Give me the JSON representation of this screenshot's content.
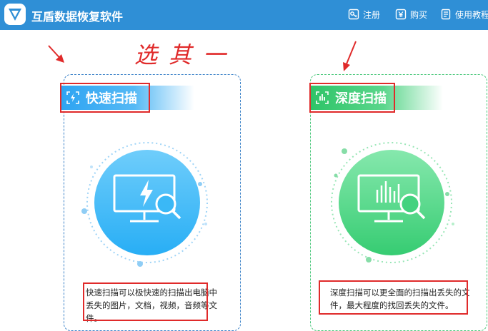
{
  "app": {
    "title": "互盾数据恢复软件"
  },
  "toolbar": {
    "register_label": "注册",
    "buy_label": "购买",
    "tutorial_label": "使用教程"
  },
  "annotation": {
    "handwriting": "选其一"
  },
  "quick_scan": {
    "label": "快速扫描",
    "description": "快速扫描可以极快速的扫描出电脑中丢失的图片，文档，视频，音频等文件。",
    "accent": "#2ea4f2"
  },
  "deep_scan": {
    "label": "深度扫描",
    "description": "深度扫描可以更全面的扫描出丢失的文件，最大程度的找回丢失的文件。",
    "accent": "#2ec468"
  },
  "colors": {
    "titlebar": "#2f8fd6",
    "annotation": "#e02a2a"
  }
}
